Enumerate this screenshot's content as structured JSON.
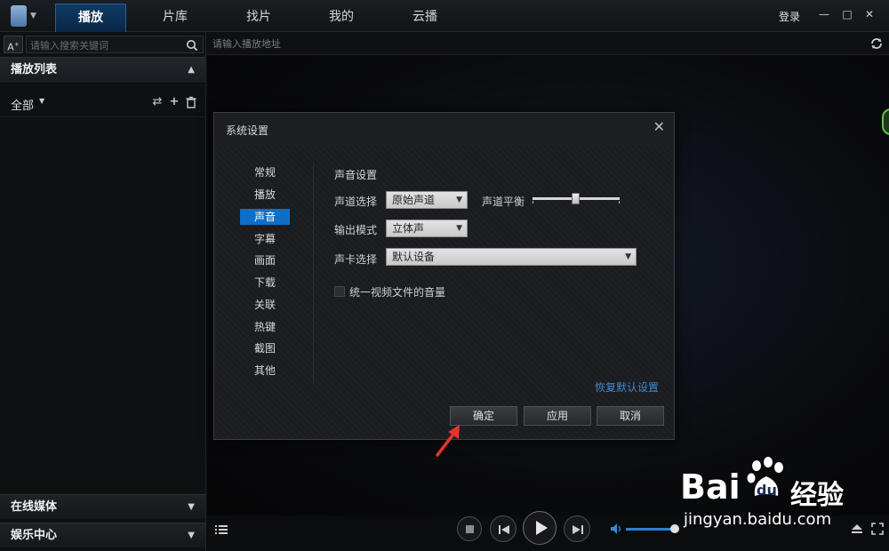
{
  "topbar": {
    "tabs": [
      {
        "label": "播放",
        "active": true
      },
      {
        "label": "片库"
      },
      {
        "label": "找片"
      },
      {
        "label": "我的"
      },
      {
        "label": "云播"
      }
    ],
    "login_label": "登录",
    "window_controls": {
      "minimize": "—",
      "maximize": "□",
      "close": "✕"
    }
  },
  "sidebar": {
    "add_label": "A",
    "search_placeholder": "请输入搜索关键词",
    "playlist_header": "播放列表",
    "filter_label": "全部",
    "bottom_sections": [
      "在线媒体",
      "娱乐中心"
    ]
  },
  "player": {
    "url_placeholder": "请输入播放地址"
  },
  "dialog": {
    "title": "系统设置",
    "close_glyph": "✕",
    "menu": [
      {
        "label": "常规"
      },
      {
        "label": "播放"
      },
      {
        "label": "声音",
        "active": true
      },
      {
        "label": "字幕"
      },
      {
        "label": "画面"
      },
      {
        "label": "下载"
      },
      {
        "label": "关联"
      },
      {
        "label": "热键"
      },
      {
        "label": "截图"
      },
      {
        "label": "其他"
      }
    ],
    "panel_title": "声音设置",
    "channel_label": "声道选择",
    "channel_value": "原始声道",
    "balance_label": "声道平衡",
    "balance_level": 0.5,
    "output_label": "输出模式",
    "output_value": "立体声",
    "soundcard_label": "声卡选择",
    "soundcard_value": "默认设备",
    "normalize_label": "统一视频文件的音量",
    "normalize_checked": false,
    "restore_label": "恢复默认设置",
    "buttons": {
      "ok": "确定",
      "apply": "应用",
      "cancel": "取消"
    }
  },
  "controls": {
    "volume_level": 0.92
  },
  "watermark": {
    "brand": "Bai",
    "brand_suffix": "du",
    "cn_text": "经验",
    "url": "jingyan.baidu.com"
  },
  "colors": {
    "accent": "#0f6fc6",
    "link": "#3e8ad6",
    "arrow": "#e8332a"
  }
}
